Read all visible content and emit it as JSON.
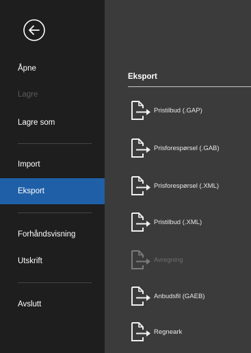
{
  "sidebar": {
    "back_icon": "arrow-left-circle-icon",
    "items": [
      {
        "label": "Åpne",
        "state": "normal"
      },
      {
        "label": "Lagre",
        "state": "disabled"
      },
      {
        "label": "Lagre som",
        "state": "normal"
      },
      {
        "label": "Import",
        "state": "normal"
      },
      {
        "label": "Eksport",
        "state": "active"
      },
      {
        "label": "Forhåndsvisning",
        "state": "normal"
      },
      {
        "label": "Utskrift",
        "state": "normal"
      },
      {
        "label": "Avslutt",
        "state": "normal"
      }
    ]
  },
  "main": {
    "section_title": "Eksport",
    "items": [
      {
        "label": "Pristilbud (.GAP)",
        "icon": "export-document-icon",
        "state": "normal"
      },
      {
        "label": "Prisforespørsel (.GAB)",
        "icon": "export-document-icon",
        "state": "normal"
      },
      {
        "label": "Prisforespørsel (.XML)",
        "icon": "export-document-icon",
        "state": "normal"
      },
      {
        "label": "Pristilbud (.XML)",
        "icon": "export-document-icon",
        "state": "normal"
      },
      {
        "label": "Avregning",
        "icon": "export-document-icon",
        "state": "disabled"
      },
      {
        "label": "Anbudsfil (GAEB)",
        "icon": "export-document-icon",
        "state": "normal"
      },
      {
        "label": "Regneark",
        "icon": "export-document-icon",
        "state": "normal"
      }
    ]
  },
  "colors": {
    "sidebar_bg": "#1e1e1e",
    "main_bg": "#3b3b3b",
    "active_bg": "#1f5fa7",
    "disabled_text": "#5a5a5a"
  }
}
